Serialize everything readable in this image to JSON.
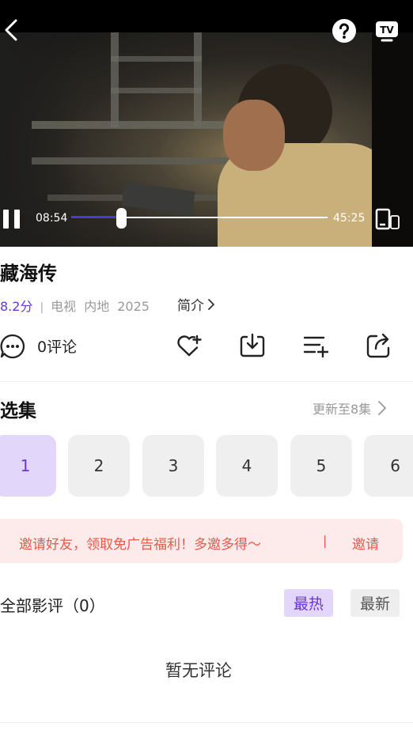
{
  "player": {
    "current_time": "08:54",
    "total_time": "45:25",
    "progress_fraction": 0.196,
    "icons": [
      "back-icon",
      "help-icon",
      "tv-icon",
      "pause-icon",
      "fullscreen-icon"
    ]
  },
  "show": {
    "title": "藏海传",
    "score": "8.2分",
    "separator": "|",
    "type": "电视",
    "region": "内地",
    "year": "2025",
    "intro_label": "简介"
  },
  "actions": {
    "comment_label": "0评论",
    "icons": [
      "comment-icon",
      "favorite-add-icon",
      "download-icon",
      "add-to-playlist-icon",
      "share-icon"
    ]
  },
  "episodes": {
    "title": "选集",
    "update_label": "更新至8集",
    "items": [
      "1",
      "2",
      "3",
      "4",
      "5",
      "6"
    ],
    "selected": "1"
  },
  "banner": {
    "text": "邀请好友，领取免广告福利！多邀多得～",
    "separator": "|",
    "action": "邀请"
  },
  "reviews": {
    "title": "全部影评（0）",
    "sort_hot": "最热",
    "sort_new": "最新",
    "empty_text": "暂无评论"
  },
  "colors": {
    "accent": "#6a35d8",
    "accent_bg": "#e2d7fb",
    "banner_bg": "#fcebea",
    "banner_text": "#e85a4a",
    "progress": "#4a3bd8"
  }
}
